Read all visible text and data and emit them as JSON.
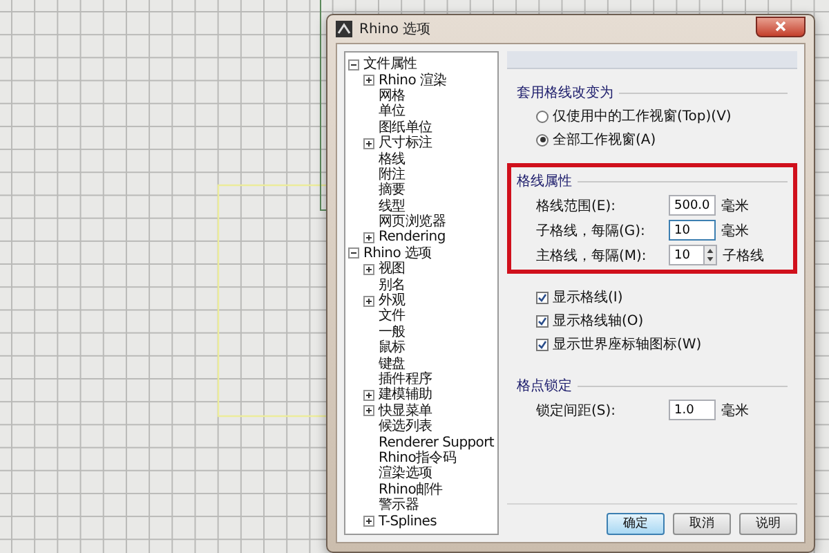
{
  "window": {
    "title": "Rhino 选项"
  },
  "tree": [
    {
      "label": "文件属性",
      "expanded": true,
      "children": [
        {
          "label": "Rhino 渲染",
          "expanded": false
        },
        {
          "label": "网格"
        },
        {
          "label": "单位"
        },
        {
          "label": "图纸单位"
        },
        {
          "label": "尺寸标注",
          "expanded": false
        },
        {
          "label": "格线"
        },
        {
          "label": "附注"
        },
        {
          "label": "摘要"
        },
        {
          "label": "线型"
        },
        {
          "label": "网页浏览器"
        },
        {
          "label": "Rendering",
          "expanded": false
        }
      ]
    },
    {
      "label": "Rhino 选项",
      "expanded": true,
      "children": [
        {
          "label": "视图",
          "expanded": false
        },
        {
          "label": "别名"
        },
        {
          "label": "外观",
          "expanded": false
        },
        {
          "label": "文件"
        },
        {
          "label": "一般"
        },
        {
          "label": "鼠标"
        },
        {
          "label": "键盘"
        },
        {
          "label": "插件程序"
        },
        {
          "label": "建模辅助",
          "expanded": false
        },
        {
          "label": "快显菜单",
          "expanded": false
        },
        {
          "label": "候选列表"
        },
        {
          "label": "Renderer Support"
        },
        {
          "label": "Rhino指令码"
        },
        {
          "label": "渲染选项"
        },
        {
          "label": "Rhino邮件"
        },
        {
          "label": "警示器"
        },
        {
          "label": "T-Splines",
          "expanded": false
        }
      ]
    }
  ],
  "grid_target": {
    "title": "套用格线改变为",
    "options": [
      {
        "label": "仅使用中的工作视窗(Top)(V)",
        "selected": false
      },
      {
        "label": "全部工作视窗(A)",
        "selected": true
      }
    ]
  },
  "grid_properties": {
    "title": "格线属性",
    "highlighted": true,
    "fields": [
      {
        "kind": "input",
        "label": "格线范围(E):",
        "value": "500.0",
        "unit": "毫米",
        "focused": false
      },
      {
        "kind": "input",
        "label": "子格线，每隔(G):",
        "value": "10",
        "unit": "毫米",
        "focused": true
      },
      {
        "kind": "spinner",
        "label": "主格线，每隔(M):",
        "value": "10",
        "unit": "子格线",
        "focused": false
      }
    ],
    "checkboxes": [
      {
        "label": "显示格线(I)",
        "checked": true
      },
      {
        "label": "显示格线轴(O)",
        "checked": true
      },
      {
        "label": "显示世界座标轴图标(W)",
        "checked": true
      }
    ]
  },
  "snap": {
    "title": "格点锁定",
    "fields": [
      {
        "kind": "input",
        "label": "锁定间距(S):",
        "value": "1.0",
        "unit": "毫米",
        "focused": false
      }
    ]
  },
  "buttons": [
    {
      "label": "确定",
      "default": true
    },
    {
      "label": "取消",
      "default": false
    },
    {
      "label": "说明",
      "default": false
    }
  ]
}
